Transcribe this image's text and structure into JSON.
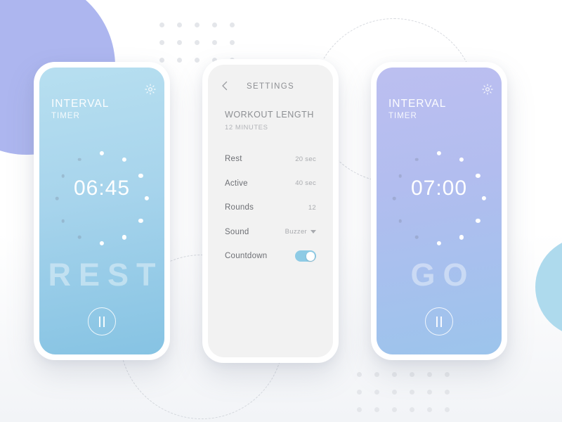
{
  "colors": {
    "bg_circle_purple": "#adb6ef",
    "bg_circle_blue": "#aedaed",
    "rest_screen_top": "#b7dff0",
    "rest_screen_bottom": "#86c3e3",
    "go_screen_top": "#bcbff0",
    "go_screen_bottom": "#9cc4ec",
    "settings_bg": "#f2f2f2",
    "toggle_on": "#8ecbe5",
    "dot_active": "#ffffff",
    "dot_inactive": "rgba(120,130,150,0.30)"
  },
  "screens": {
    "rest": {
      "brand_line1": "INTERVAL",
      "brand_line2": "TIMER",
      "gear_icon": "gear-icon",
      "time": "06:45",
      "state_word": "REST",
      "pause_icon": "pause-icon",
      "dial": {
        "total_dots": 12,
        "active_dots": 7,
        "radius": 64
      }
    },
    "settings": {
      "back_icon": "chevron-left-icon",
      "title": "SETTINGS",
      "section_header": "WORKOUT LENGTH",
      "section_sub": "12 MINUTES",
      "rows": [
        {
          "label": "Rest",
          "value": "20 sec",
          "control": "text"
        },
        {
          "label": "Active",
          "value": "40 sec",
          "control": "text"
        },
        {
          "label": "Rounds",
          "value": "12",
          "control": "text"
        },
        {
          "label": "Sound",
          "value": "Buzzer",
          "control": "dropdown"
        },
        {
          "label": "Countdown",
          "value": "on",
          "control": "toggle"
        }
      ]
    },
    "go": {
      "brand_line1": "INTERVAL",
      "brand_line2": "TIMER",
      "gear_icon": "gear-icon",
      "time": "07:00",
      "state_word": "GO",
      "pause_icon": "pause-icon",
      "dial": {
        "total_dots": 12,
        "active_dots": 7,
        "radius": 64
      }
    }
  },
  "decorations": {
    "dot_grid_top": {
      "cols": 5,
      "rows": 3
    },
    "dot_grid_bottom": {
      "cols": 6,
      "rows": 3
    },
    "dashed_rings": 2
  }
}
